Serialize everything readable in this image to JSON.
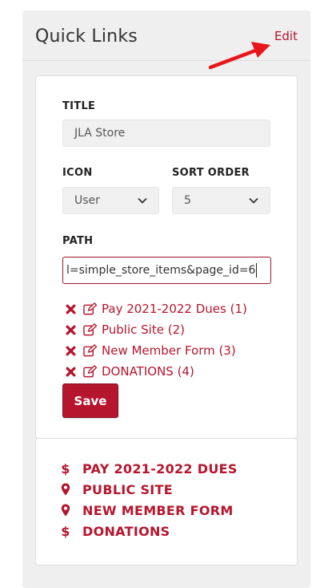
{
  "panel": {
    "title": "Quick Links",
    "edit_label": "Edit"
  },
  "form": {
    "title_label": "TITLE",
    "title_value": "JLA Store",
    "icon_label": "ICON",
    "icon_value": "User",
    "sort_label": "SORT ORDER",
    "sort_value": "5",
    "path_label": "PATH",
    "path_value": "l=simple_store_items&page_id=6",
    "save_label": "Save"
  },
  "edit_items": [
    {
      "label": "Pay 2021-2022 Dues (1)"
    },
    {
      "label": "Public Site (2)"
    },
    {
      "label": "New Member Form (3)"
    },
    {
      "label": "DONATIONS (4)"
    }
  ],
  "links": [
    {
      "icon": "dollar-icon",
      "label": "PAY 2021-2022 DUES"
    },
    {
      "icon": "map-pin-icon",
      "label": "PUBLIC SITE"
    },
    {
      "icon": "map-pin-icon",
      "label": "NEW MEMBER FORM"
    },
    {
      "icon": "dollar-icon",
      "label": "DONATIONS"
    }
  ],
  "colors": {
    "accent": "#b5162e",
    "annotation_arrow": "#e8161b"
  }
}
